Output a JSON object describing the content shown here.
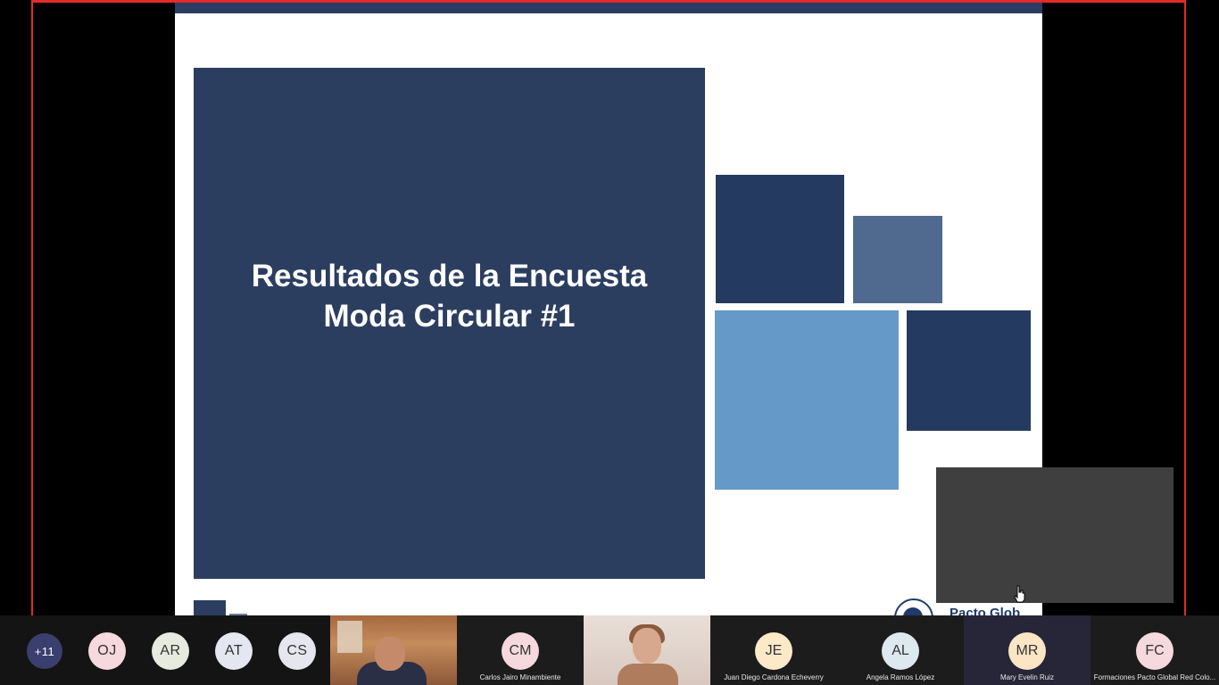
{
  "slide": {
    "title_line1": "Resultados de la Encuesta",
    "title_line2": "Moda Circular #1",
    "logo_text": "Pacto Glob"
  },
  "participants": {
    "more_count": "+11",
    "chips": [
      {
        "initials": "OJ",
        "color": "#f6d8df"
      },
      {
        "initials": "AR",
        "color": "#e7eadf"
      },
      {
        "initials": "AT",
        "color": "#e4e6f0"
      },
      {
        "initials": "CS",
        "color": "#e6e6ee"
      }
    ],
    "tiles": [
      {
        "type": "video",
        "name": ""
      },
      {
        "type": "avatar",
        "initials": "CM",
        "color": "#f6d8df",
        "name": "Carlos Jairo Minambiente"
      },
      {
        "type": "video",
        "name": ""
      },
      {
        "type": "avatar",
        "initials": "JE",
        "color": "#fbe9c8",
        "name": "Juan Diego Cardona Echeverry"
      },
      {
        "type": "avatar",
        "initials": "AL",
        "color": "#dde8ef",
        "name": "Angela Ramos López"
      },
      {
        "type": "avatar",
        "initials": "MR",
        "color": "#fbe5c4",
        "name": "Mary Evelin Ruiz"
      },
      {
        "type": "avatar",
        "initials": "FC",
        "color": "#f6d8df",
        "name": "Formaciones Pacto Global Red Colo..."
      }
    ]
  },
  "colors": {
    "share_border": "#e32a2a",
    "slide_dark_blue": "#2c3e60",
    "slide_light_blue": "#6599c8"
  }
}
